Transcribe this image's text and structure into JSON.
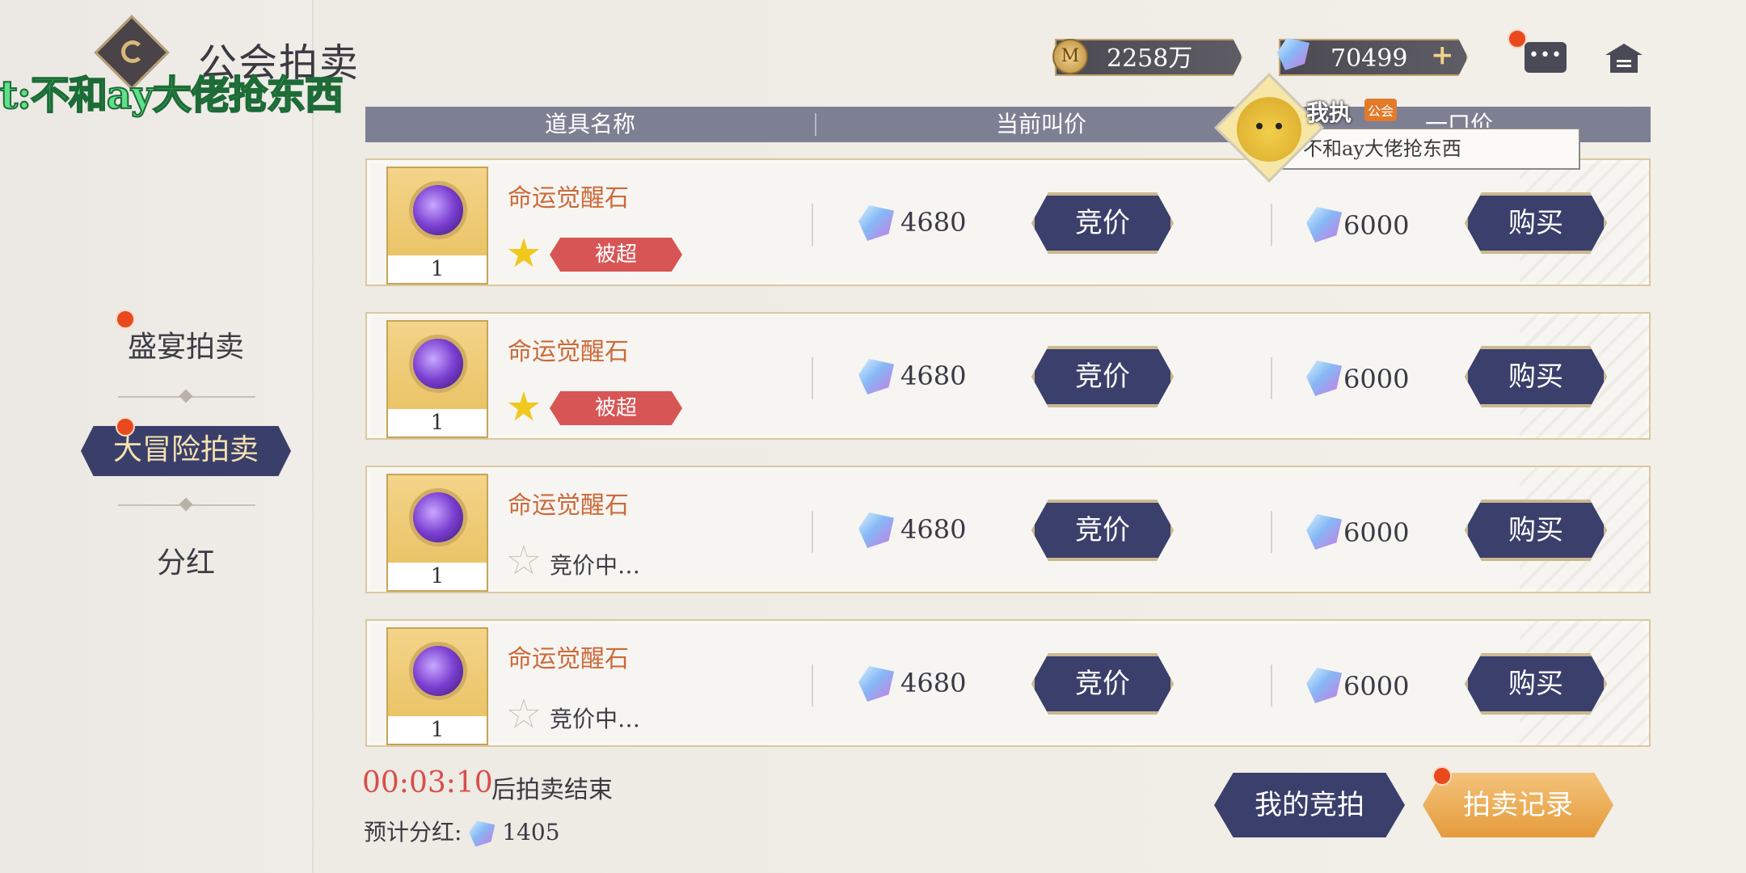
{
  "header": {
    "title": "公会拍卖",
    "overlay": "t:不和ay大佬抢东西",
    "gold": "2258万",
    "gems": "70499",
    "plus": "+",
    "chat": "•••"
  },
  "sidebar": {
    "items": [
      {
        "label": "盛宴拍卖"
      },
      {
        "label": "大冒险拍卖"
      },
      {
        "label": "分红"
      }
    ]
  },
  "chat_bubble": {
    "player": "我执",
    "guild_tag": "公会",
    "message": "不和ay大佬抢东西"
  },
  "table": {
    "headers": [
      "道具名称",
      "当前叫价",
      "一口价"
    ],
    "bid_label": "竞价",
    "buy_label": "购买",
    "rows": [
      {
        "name": "命运觉醒石",
        "count": "1",
        "status": "被超",
        "starred": true,
        "current_bid": "4680",
        "buyout": "6000"
      },
      {
        "name": "命运觉醒石",
        "count": "1",
        "status": "被超",
        "starred": true,
        "current_bid": "4680",
        "buyout": "6000"
      },
      {
        "name": "命运觉醒石",
        "count": "1",
        "status": "竞价中…",
        "starred": false,
        "current_bid": "4680",
        "buyout": "6000"
      },
      {
        "name": "命运觉醒石",
        "count": "1",
        "status": "竞价中…",
        "starred": false,
        "current_bid": "4680",
        "buyout": "6000"
      }
    ]
  },
  "footer": {
    "timer": "00:03:10",
    "timer_label": "后拍卖结束",
    "dividend_label": "预计分红:",
    "dividend_value": "1405",
    "my_bids": "我的竞拍",
    "records": "拍卖记录"
  }
}
